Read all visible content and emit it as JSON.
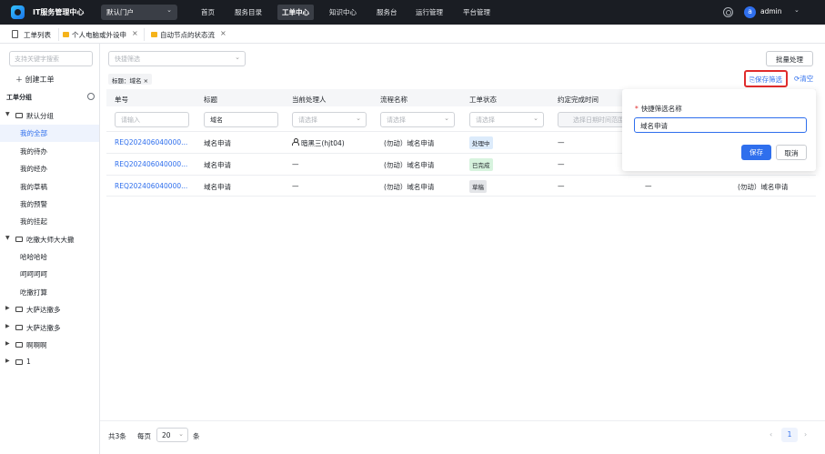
{
  "topbar": {
    "app_title": "IT服务管理中心",
    "portal": "默认门户",
    "nav": [
      "首页",
      "服务目录",
      "工单中心",
      "知识中心",
      "服务台",
      "运行管理",
      "平台管理"
    ],
    "active_nav": "工单中心",
    "avatar_letter": "a",
    "user": "admin"
  },
  "tabs": [
    {
      "label": "工单列表",
      "icon": "document-icon"
    },
    {
      "label": "个人电脑或外设申",
      "icon": "folder-icon"
    },
    {
      "label": "自动节点的状态流",
      "icon": "folder-icon"
    }
  ],
  "sidebar": {
    "search_placeholder": "支持关键字搜索",
    "create_label": "创建工单",
    "group_title": "工单分组",
    "tree": [
      {
        "label": "默认分组",
        "type": "folder",
        "expanded": true
      },
      {
        "label": "我的全部",
        "type": "item",
        "selected": true
      },
      {
        "label": "我的待办",
        "type": "item"
      },
      {
        "label": "我的经办",
        "type": "item"
      },
      {
        "label": "我的草稿",
        "type": "item"
      },
      {
        "label": "我的预警",
        "type": "item"
      },
      {
        "label": "我的挂起",
        "type": "item"
      },
      {
        "label": "吃撒大师大大撒",
        "type": "folder",
        "expanded": true
      },
      {
        "label": "哈哈哈哈",
        "type": "item"
      },
      {
        "label": "呵呵呵呵",
        "type": "item"
      },
      {
        "label": "吃撒打算",
        "type": "item"
      },
      {
        "label": "大萨达撒多",
        "type": "folder",
        "expanded": false
      },
      {
        "label": "大萨达撒多",
        "type": "folder",
        "expanded": false
      },
      {
        "label": "啊啊啊",
        "type": "folder",
        "expanded": false
      },
      {
        "label": "1",
        "type": "folder",
        "expanded": false
      }
    ]
  },
  "main": {
    "quick_filter_placeholder": "快捷筛选",
    "bulk_button": "批量处理",
    "filter_tag": "标题：域名",
    "save_filter": "保存筛选",
    "clear_filter": "清空",
    "columns": [
      "单号",
      "标题",
      "当前处理人",
      "流程名称",
      "工单状态",
      "约定完成时间"
    ],
    "filters": {
      "id_placeholder": "请输入",
      "title_value": "域名",
      "handler_placeholder": "请选择",
      "process_placeholder": "请选择",
      "status_placeholder": "请选择",
      "time_placeholder": "选择日期时间范围"
    },
    "rows": [
      {
        "id": "REQ202406040000...",
        "title": "域名申请",
        "handler": "暗黑三(hjt04)",
        "process": "(勿动）域名申请",
        "status": "处理中",
        "status_kind": "processing",
        "due": "—",
        "extra1": "",
        "extra2": ""
      },
      {
        "id": "REQ202406040000...",
        "title": "域名申请",
        "handler": "—",
        "process": "(勿动）域名申请",
        "status": "已完成",
        "status_kind": "done",
        "due": "—",
        "extra1": "",
        "extra2": ""
      },
      {
        "id": "REQ202406040000...",
        "title": "域名申请",
        "handler": "—",
        "process": "(勿动）域名申请",
        "status": "草稿",
        "status_kind": "draft",
        "due": "—",
        "extra1": "—",
        "extra2": "(勿动）域名申请"
      }
    ]
  },
  "popover": {
    "required_mark": "*",
    "label": "快捷筛选名称",
    "value": "域名申请",
    "save": "保存",
    "cancel": "取消"
  },
  "pagination": {
    "total": "共3条",
    "per_page_label": "每页",
    "page_size": "20",
    "unit": "条",
    "prev": "‹",
    "current": "1",
    "next": "›"
  }
}
